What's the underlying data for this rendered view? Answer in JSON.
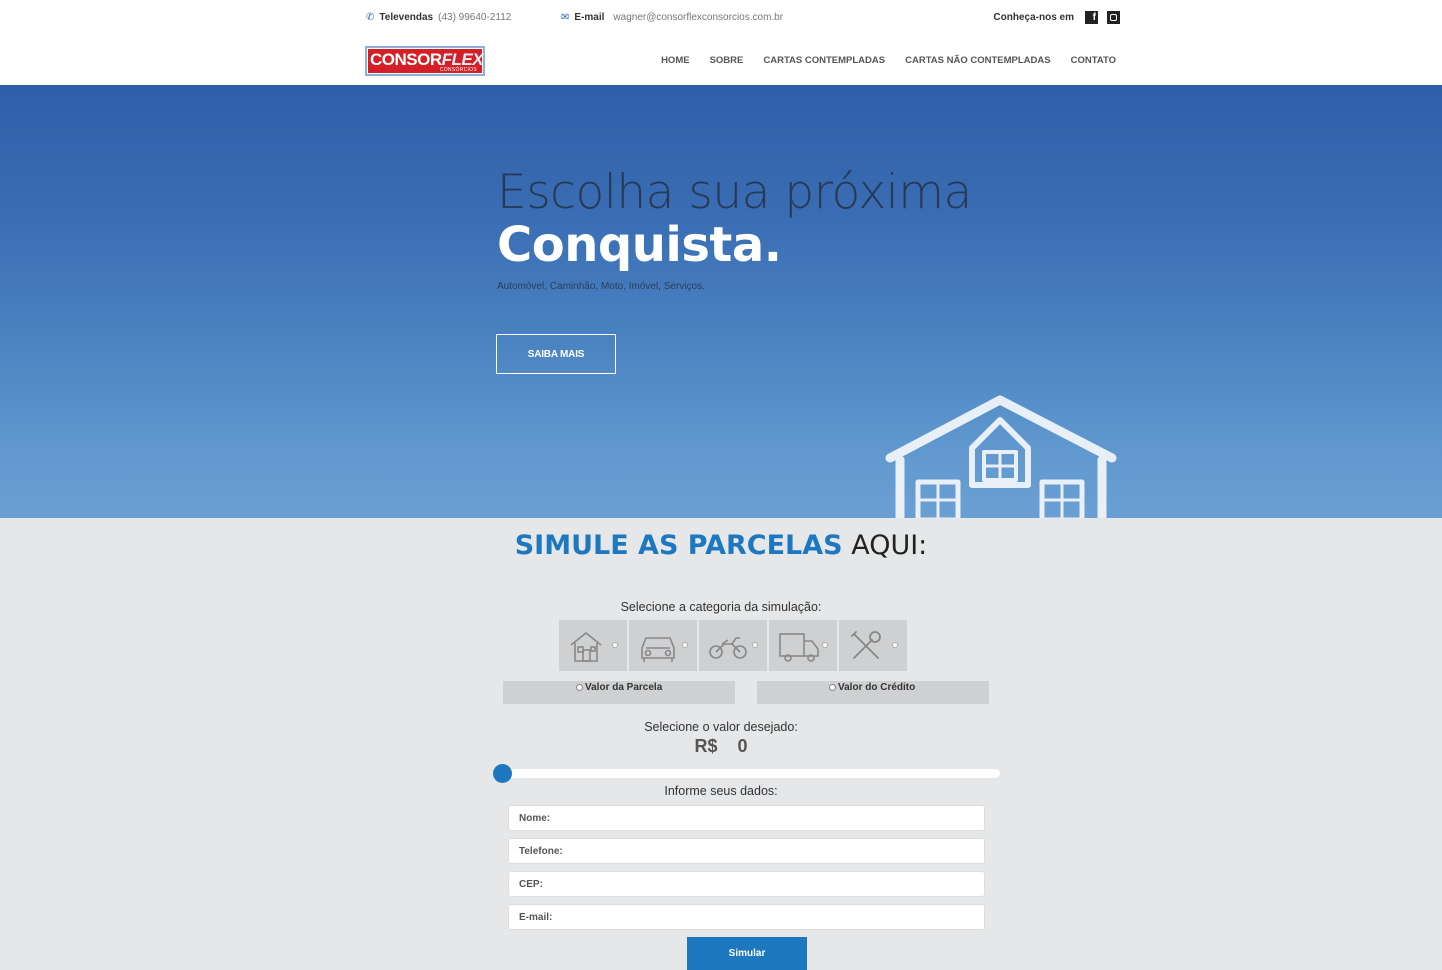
{
  "topbar": {
    "phone_label": "Televendas",
    "phone_value": "(43) 99640-2112",
    "email_label": "E-mail",
    "email_value": "wagner@consorflexconsorcios.com.br",
    "social_label": "Conheça-nos em",
    "facebook_glyph": "f"
  },
  "logo": {
    "brand_a": "CONSOR",
    "brand_b": "FLEX",
    "sub": "CONSÓRCIOS"
  },
  "nav": {
    "items": [
      "HOME",
      "SOBRE",
      "CARTAS CONTEMPLADAS",
      "CARTAS NÃO CONTEMPLADAS",
      "CONTATO"
    ]
  },
  "hero": {
    "title_line1": "Escolha sua próxima",
    "title_line2": "Conquista.",
    "tagline": "Automóvel, Caminhão, Moto, Imóvel, Serviços.",
    "cta": "SAIBA MAIS"
  },
  "simulator": {
    "title_strong": "SIMULE AS PARCELAS",
    "title_rest": "AQUI:",
    "category_label": "Selecione a categoria da simulação:",
    "categories": [
      "house-icon",
      "car-icon",
      "motorcycle-icon",
      "truck-icon",
      "tools-icon"
    ],
    "modes": [
      "Valor da Parcela",
      "Valor do Crédito"
    ],
    "value_label": "Selecione o valor desejado:",
    "currency": "R$",
    "amount": "0",
    "slider_value": 0,
    "data_label": "Informe seus dados:",
    "fields": {
      "name": "Nome:",
      "phone": "Telefone:",
      "cep": "CEP:",
      "email": "E-mail:"
    },
    "submit": "Simular",
    "accent_color": "#1e78c0"
  }
}
